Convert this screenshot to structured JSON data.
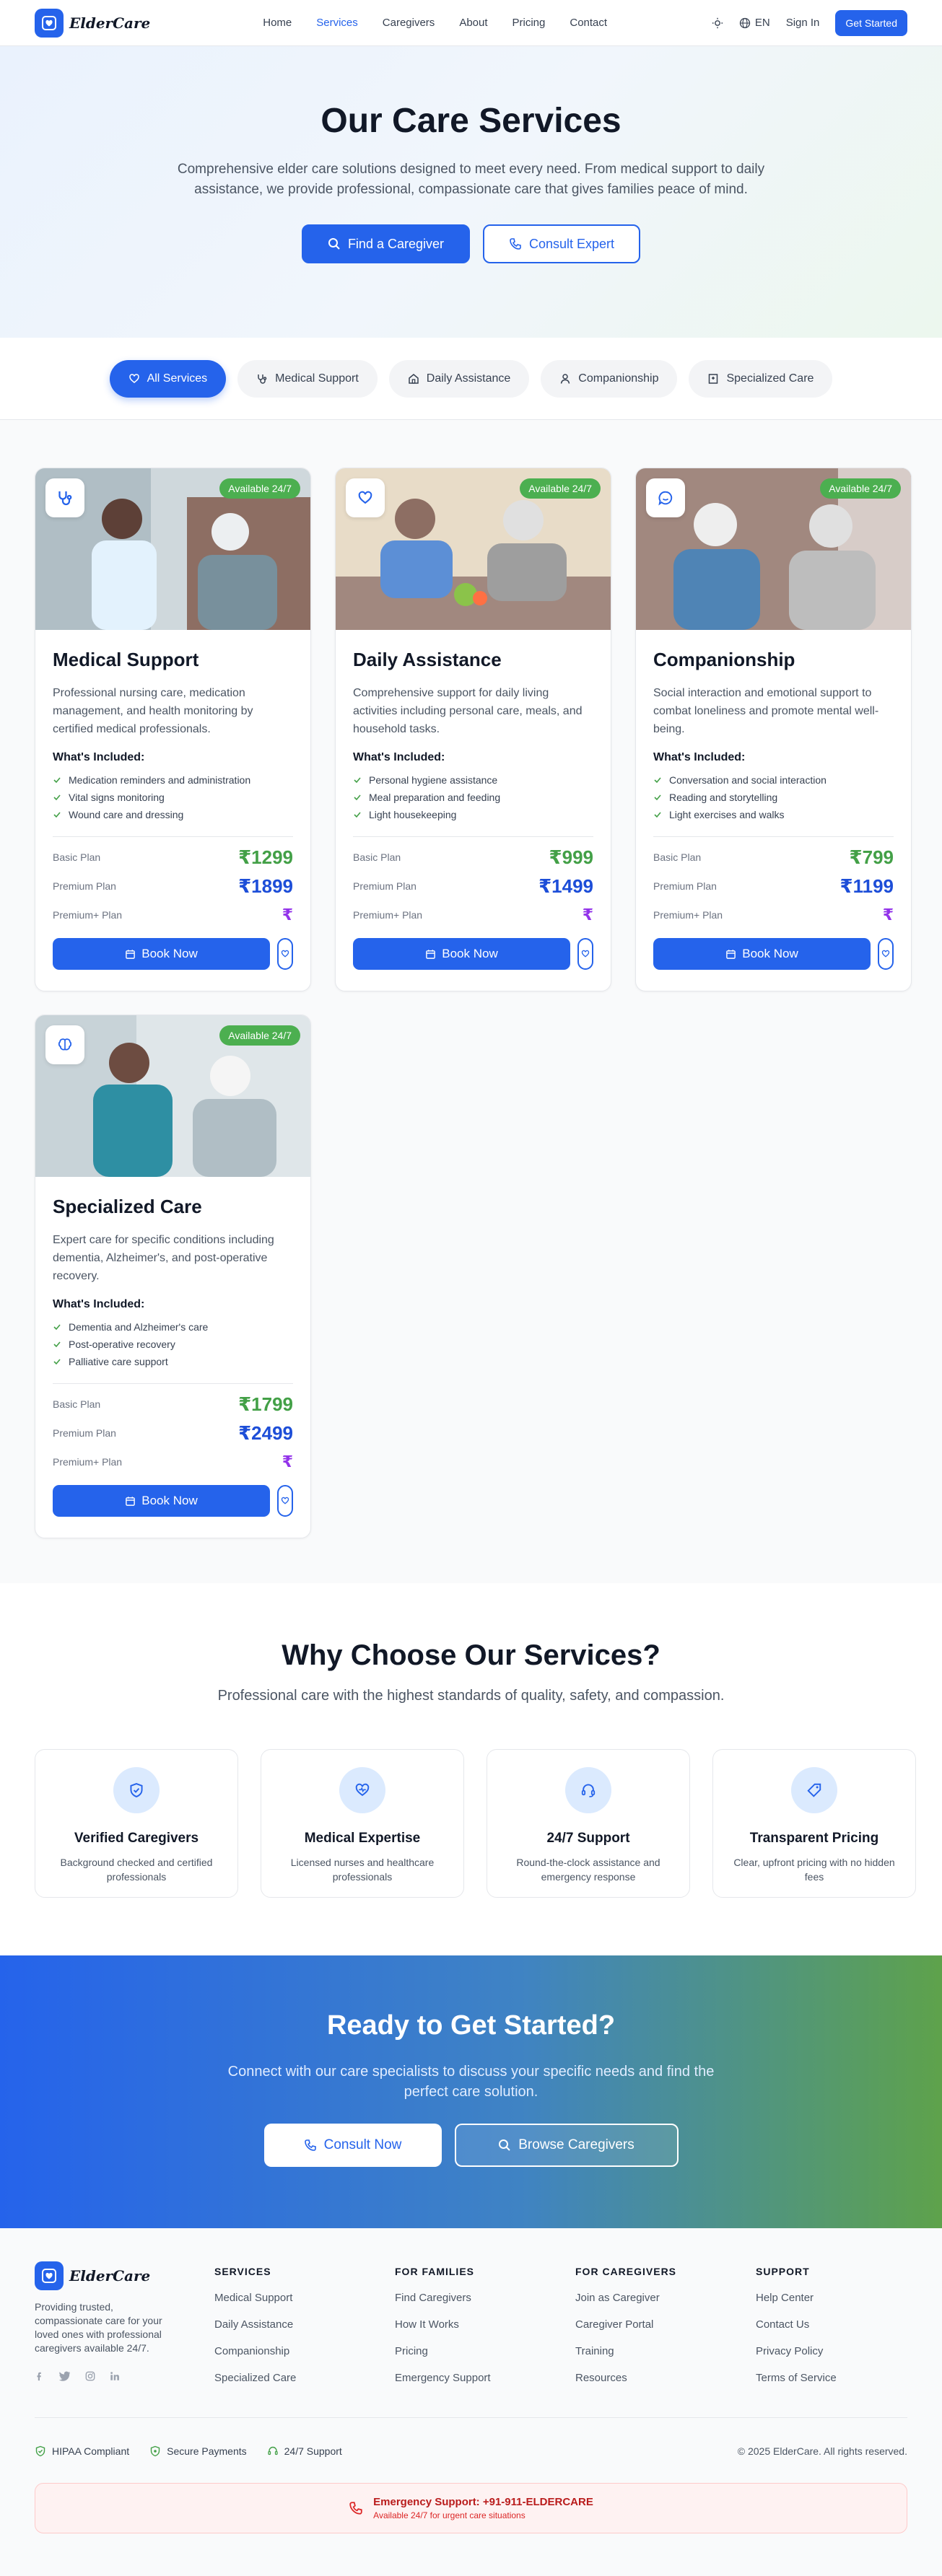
{
  "brand": {
    "name": "ElderCare"
  },
  "nav": {
    "links": [
      "Home",
      "Services",
      "Caregivers",
      "About",
      "Pricing",
      "Contact"
    ],
    "active": "Services",
    "lang": "EN",
    "sign_in": "Sign In",
    "get_started": "Get Started"
  },
  "hero": {
    "title": "Our Care Services",
    "subtitle": "Comprehensive elder care solutions designed to meet every need. From medical support to daily assistance, we provide professional, compassionate care that gives families peace of mind.",
    "primary_cta": "Find a Caregiver",
    "secondary_cta": "Consult Expert"
  },
  "filters": [
    "All Services",
    "Medical Support",
    "Daily Assistance",
    "Companionship",
    "Specialized Care"
  ],
  "services": [
    {
      "title": "Medical Support",
      "badge": "Available 24/7",
      "icon": "stethoscope-icon",
      "description": "Professional nursing care, medication management, and health monitoring by certified medical professionals.",
      "included_title": "What's Included:",
      "included": [
        "Medication reminders and administration",
        "Vital signs monitoring",
        "Wound care and dressing"
      ],
      "plans": [
        {
          "name": "Basic Plan",
          "price": "₹1299"
        },
        {
          "name": "Premium Plan",
          "price": "₹1899"
        },
        {
          "name": "Premium+ Plan",
          "price": "₹"
        }
      ],
      "book_label": "Book Now"
    },
    {
      "title": "Daily Assistance",
      "badge": "Available 24/7",
      "icon": "heart-icon",
      "description": "Comprehensive support for daily living activities including personal care, meals, and household tasks.",
      "included_title": "What's Included:",
      "included": [
        "Personal hygiene assistance",
        "Meal preparation and feeding",
        "Light housekeeping"
      ],
      "plans": [
        {
          "name": "Basic Plan",
          "price": "₹999"
        },
        {
          "name": "Premium Plan",
          "price": "₹1499"
        },
        {
          "name": "Premium+ Plan",
          "price": "₹"
        }
      ],
      "book_label": "Book Now"
    },
    {
      "title": "Companionship",
      "badge": "Available 24/7",
      "icon": "chat-icon",
      "description": "Social interaction and emotional support to combat loneliness and promote mental well-being.",
      "included_title": "What's Included:",
      "included": [
        "Conversation and social interaction",
        "Reading and storytelling",
        "Light exercises and walks"
      ],
      "plans": [
        {
          "name": "Basic Plan",
          "price": "₹799"
        },
        {
          "name": "Premium Plan",
          "price": "₹1199"
        },
        {
          "name": "Premium+ Plan",
          "price": "₹"
        }
      ],
      "book_label": "Book Now"
    },
    {
      "title": "Specialized Care",
      "badge": "Available 24/7",
      "icon": "brain-icon",
      "description": "Expert care for specific conditions including dementia, Alzheimer's, and post-operative recovery.",
      "included_title": "What's Included:",
      "included": [
        "Dementia and Alzheimer's care",
        "Post-operative recovery",
        "Palliative care support"
      ],
      "plans": [
        {
          "name": "Basic Plan",
          "price": "₹1799"
        },
        {
          "name": "Premium Plan",
          "price": "₹2499"
        },
        {
          "name": "Premium+ Plan",
          "price": "₹"
        }
      ],
      "book_label": "Book Now"
    }
  ],
  "why": {
    "title": "Why Choose Our Services?",
    "subtitle": "Professional care with the highest standards of quality, safety, and compassion.",
    "items": [
      {
        "title": "Verified Caregivers",
        "desc": "Background checked and certified professionals",
        "icon": "shield-check-icon"
      },
      {
        "title": "Medical Expertise",
        "desc": "Licensed nurses and healthcare professionals",
        "icon": "stethoscope-icon"
      },
      {
        "title": "24/7 Support",
        "desc": "Round-the-clock assistance and emergency response",
        "icon": "headset-icon"
      },
      {
        "title": "Transparent Pricing",
        "desc": "Clear, upfront pricing with no hidden fees",
        "icon": "tag-icon"
      }
    ]
  },
  "cta": {
    "title": "Ready to Get Started?",
    "subtitle": "Connect with our care specialists to discuss your specific needs and find the perfect care solution.",
    "primary": "Consult Now",
    "secondary": "Browse Caregivers"
  },
  "footer": {
    "description": "Providing trusted, compassionate care for your loved ones with professional caregivers available 24/7.",
    "columns": [
      {
        "title": "SERVICES",
        "links": [
          "Medical Support",
          "Daily Assistance",
          "Companionship",
          "Specialized Care"
        ]
      },
      {
        "title": "FOR FAMILIES",
        "links": [
          "Find Caregivers",
          "How It Works",
          "Pricing",
          "Emergency Support"
        ]
      },
      {
        "title": "FOR CAREGIVERS",
        "links": [
          "Join as Caregiver",
          "Caregiver Portal",
          "Training",
          "Resources"
        ]
      },
      {
        "title": "SUPPORT",
        "links": [
          "Help Center",
          "Contact Us",
          "Privacy Policy",
          "Terms of Service"
        ]
      }
    ],
    "trust": [
      "HIPAA Compliant",
      "Secure Payments",
      "24/7 Support"
    ],
    "copyright": "© 2025 ElderCare. All rights reserved.",
    "emergency_title": "Emergency Support: +91-911-ELDERCARE",
    "emergency_sub": "Available 24/7 for urgent care situations"
  },
  "colors": {
    "primary": "#2563eb",
    "green": "#43a047",
    "purple": "#9333ea",
    "danger": "#b91c1c"
  }
}
